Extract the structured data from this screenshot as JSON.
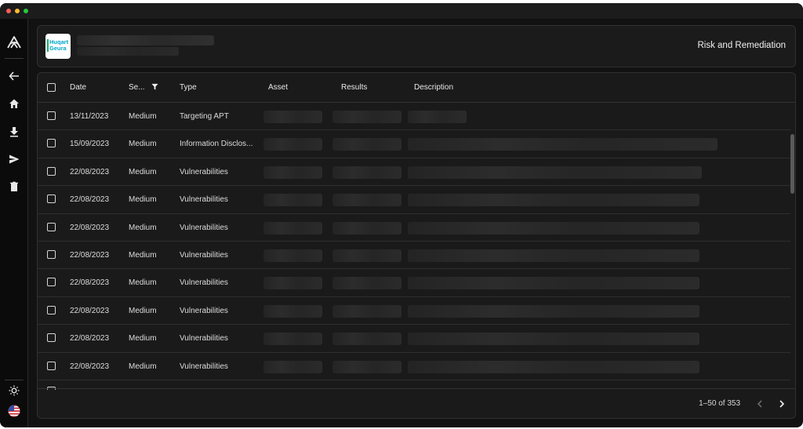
{
  "window": {
    "controls": [
      "close",
      "minimize",
      "maximize"
    ]
  },
  "sidebar": {
    "items": [
      {
        "icon": "app-logo-icon"
      },
      {
        "icon": "back-arrow-icon"
      },
      {
        "icon": "home-icon"
      },
      {
        "icon": "download-icon"
      },
      {
        "icon": "send-icon"
      },
      {
        "icon": "trash-icon"
      }
    ],
    "bottom": [
      {
        "icon": "theme-sun-icon"
      },
      {
        "icon": "us-flag-icon"
      }
    ]
  },
  "header": {
    "logo_text": "Huqart\nGeura",
    "title": "Risk and Remediation"
  },
  "table": {
    "columns": {
      "date": "Date",
      "severity": "Se...",
      "type": "Type",
      "asset": "Asset",
      "results": "Results",
      "description": "Description"
    },
    "rows": [
      {
        "date": "13/11/2023",
        "severity": "Medium",
        "type": "Targeting APT"
      },
      {
        "date": "15/09/2023",
        "severity": "Medium",
        "type": "Information Disclos..."
      },
      {
        "date": "22/08/2023",
        "severity": "Medium",
        "type": "Vulnerabilities"
      },
      {
        "date": "22/08/2023",
        "severity": "Medium",
        "type": "Vulnerabilities"
      },
      {
        "date": "22/08/2023",
        "severity": "Medium",
        "type": "Vulnerabilities"
      },
      {
        "date": "22/08/2023",
        "severity": "Medium",
        "type": "Vulnerabilities"
      },
      {
        "date": "22/08/2023",
        "severity": "Medium",
        "type": "Vulnerabilities"
      },
      {
        "date": "22/08/2023",
        "severity": "Medium",
        "type": "Vulnerabilities"
      },
      {
        "date": "22/08/2023",
        "severity": "Medium",
        "type": "Vulnerabilities"
      },
      {
        "date": "22/08/2023",
        "severity": "Medium",
        "type": "Vulnerabilities"
      }
    ]
  },
  "pagination": {
    "text": "1–50 of 353"
  },
  "colors": {
    "background": "#121212",
    "panel": "#1b1b1b",
    "border": "#303030",
    "logo_accent": "#00a7c8"
  }
}
